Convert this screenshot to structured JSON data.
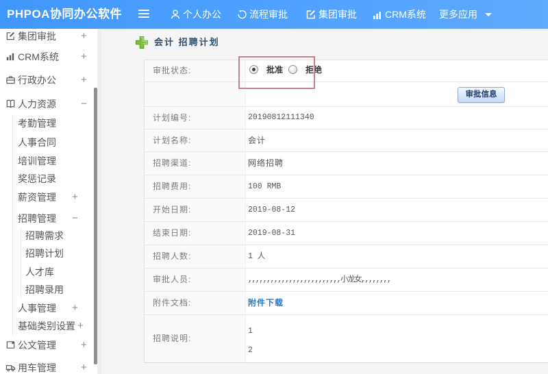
{
  "header": {
    "logo": "PHPOA协同办公软件",
    "nav": [
      {
        "label": "个人办公",
        "icon": "person-icon"
      },
      {
        "label": "流程审批",
        "icon": "history-icon"
      },
      {
        "label": "集团审批",
        "icon": "edit-icon"
      },
      {
        "label": "CRM系统",
        "icon": "bar-chart-icon"
      },
      {
        "label": "更多应用",
        "icon": "caret-down-icon"
      }
    ]
  },
  "sidebar": {
    "items": [
      {
        "label": "集团审批",
        "level": 1,
        "icon": "edit-icon",
        "expander": "+"
      },
      {
        "label": "CRM系统",
        "level": 1,
        "icon": "bar-chart-icon",
        "expander": "+"
      },
      {
        "label": "行政办公",
        "level": 1,
        "icon": "briefcase-icon",
        "expander": "+"
      },
      {
        "label": "人力资源",
        "level": 1,
        "icon": "book-icon",
        "expander": "−"
      },
      {
        "label": "考勤管理",
        "level": 2
      },
      {
        "label": "人事合同",
        "level": 2
      },
      {
        "label": "培训管理",
        "level": 2
      },
      {
        "label": "奖惩记录",
        "level": 2
      },
      {
        "label": "薪资管理",
        "level": 2,
        "expander": "+"
      },
      {
        "label": "招聘管理",
        "level": 2,
        "expander": "−"
      },
      {
        "label": "招聘需求",
        "level": 3
      },
      {
        "label": "招聘计划",
        "level": 3
      },
      {
        "label": "人才库",
        "level": 3
      },
      {
        "label": "招聘录用",
        "level": 3
      },
      {
        "label": "人事管理",
        "level": 2,
        "expander": "+"
      },
      {
        "label": "基础类别设置",
        "level": 2,
        "expander": "+"
      },
      {
        "label": "公文管理",
        "level": 1,
        "icon": "document-icon",
        "expander": "+"
      },
      {
        "label": "用车管理",
        "level": 1,
        "icon": "truck-icon",
        "expander": "+"
      }
    ]
  },
  "main": {
    "title": "会计 招聘计划",
    "approval_status": {
      "label": "审批状态:",
      "options": [
        {
          "label": "批准",
          "selected": true
        },
        {
          "label": "拒绝",
          "selected": false
        }
      ]
    },
    "approve_info_button": "审批信息",
    "fields": [
      {
        "label": "计划编号:",
        "value": "20190812111340"
      },
      {
        "label": "计划名称:",
        "value": "会计"
      },
      {
        "label": "招聘渠道:",
        "value": "网络招聘"
      },
      {
        "label": "招聘费用:",
        "value": "100 RMB"
      },
      {
        "label": "开始日期:",
        "value": "2019-08-12"
      },
      {
        "label": "结束日期:",
        "value": "2019-08-31"
      },
      {
        "label": "招聘人数:",
        "value": "1 人"
      },
      {
        "label": "审批人员:",
        "value": ",,,,,,,,,,,,,,,,,,,,,,,,,小龙女,,,,,,,,"
      },
      {
        "label": "附件文档:",
        "value": "附件下载"
      },
      {
        "label": "招聘说明:",
        "value_lines": [
          "1",
          "2"
        ]
      }
    ]
  },
  "colors": {
    "header_blue": "#4da0ff",
    "content_bg": "#f5f5f5",
    "label_cell_bg": "#fafafc",
    "red_box_border": "#c5808c",
    "link_blue": "#2878c8",
    "title_navy": "#2f4e6e"
  }
}
